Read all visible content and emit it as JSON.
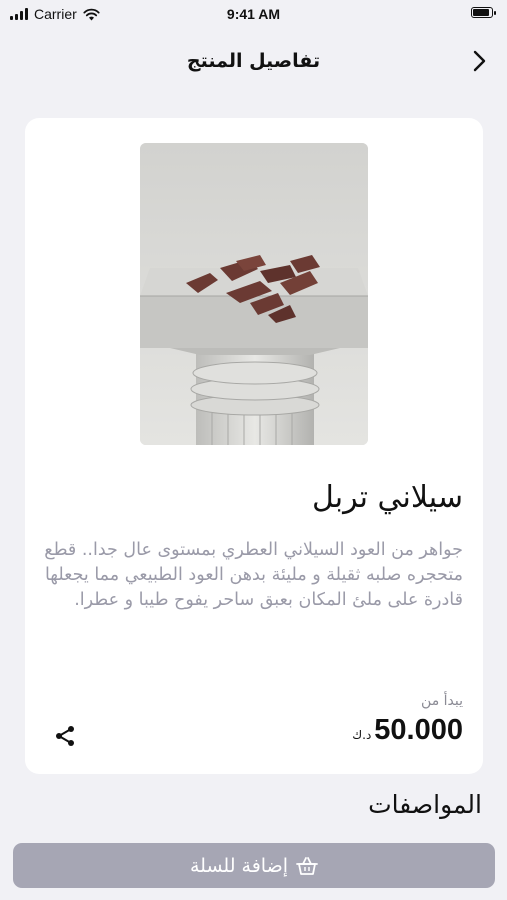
{
  "status_bar": {
    "carrier": "Carrier",
    "time": "9:41 AM"
  },
  "nav": {
    "title": "تفاصيل المنتج"
  },
  "product": {
    "title": "سيلاني تربل",
    "description": "جواهر من العود السيلاني العطري بمستوى عال جدا.. قطع متحجره صلبه ثقيلة و مليئة بدهن العود الطبيعي مما يجعلها قادرة على ملئ المكان بعبق ساحر يفوح طيبا و عطرا.",
    "price_label": "يبدأ من",
    "price": "50.000",
    "currency": "د.ك"
  },
  "specs": {
    "title": "المواصفات"
  },
  "cart_button": {
    "label": "إضافة للسلة"
  },
  "colors": {
    "accent_disabled": "#a6a6b4",
    "background": "#f1f1f5",
    "muted_text": "#9a9aa8"
  }
}
